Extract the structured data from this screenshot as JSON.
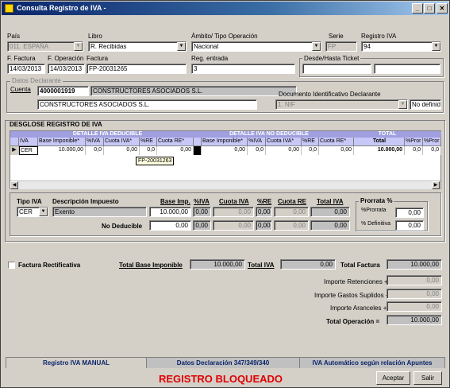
{
  "window": {
    "title": "Consulta Registro de IVA -"
  },
  "header": {
    "pais_label": "País",
    "pais_value": "011. ESPAÑA",
    "libro_label": "Libro",
    "libro_value": "R. Recibidas",
    "ambito_label": "Ámbito/ Tipo Operación",
    "ambito_value": "Nacional",
    "serie_label": "Serie",
    "serie_value": "FP",
    "registro_label": "Registro IVA",
    "registro_value": "94",
    "ffactura_label": "F. Factura",
    "ffactura_value": "14/03/2013",
    "foperacion_label": "F. Operación",
    "foperacion_value": "14/03/2013",
    "factura_label": "Factura",
    "factura_value": "FP-20031265",
    "regentrada_label": "Reg. entrada",
    "regentrada_value": "3",
    "desdehasta_label": "Desde/Hasta Ticket"
  },
  "declarante": {
    "group_label": "Datos Declarante",
    "cuenta_label": "Cuenta",
    "cuenta_value": "4000001919",
    "cuenta_name": "CONSTRUCTORES ASOCIADOS S.L.",
    "name_value": "CONSTRUCTORES ASOCIADOS S.L.",
    "doc_label": "Documento Identificativo Declarante",
    "doc_type": "1. NIF",
    "doc_value": "No definido"
  },
  "desglose": {
    "title": "DESGLOSE REGISTRO DE IVA",
    "group_deducible": "DETALLE IVA DEDUCIBLE",
    "group_nodeducible": "DETALLE IVA NO DEDUCIBLE",
    "group_total": "TOTAL",
    "columns": [
      "IVA",
      "Base Imponible*",
      "%IVA",
      "Cuota IVA*",
      "%RE",
      "Cuota RE*",
      "Base Imponible*",
      "%IVA",
      "Cuota IVA*",
      "%RE",
      "Cuota RE*",
      "Total",
      "%Pror",
      "%Pror"
    ],
    "row": [
      "CER",
      "10.000,00",
      "0,0",
      "0,00",
      "0,0",
      "0,00",
      "0,00",
      "0,0",
      "0,00",
      "0,0",
      "0,00",
      "10.000,00",
      "0,0",
      "0,0"
    ],
    "tooltip": "FP-20031263"
  },
  "detalle": {
    "tipo_label": "Tipo IVA",
    "tipo_value": "CER",
    "desc_label": "Descripción Impuesto",
    "desc_value": "Exento",
    "base_label": "Base Imp.",
    "piva_label": "%IVA",
    "cuota_label": "Cuota IVA",
    "pre_label": "%RE",
    "cuotare_label": "Cuota RE",
    "total_label": "Total IVA",
    "ded": {
      "base": "10.000,00",
      "piva": "0,00",
      "cuota": "0,00",
      "pre": "0,00",
      "cuotare": "0,00",
      "total": "0,00"
    },
    "nodeducible_label": "No  Deducible",
    "nd": {
      "base": "0,00",
      "piva": "0,00",
      "cuota": "0,00",
      "pre": "0,00",
      "cuotare": "0,00",
      "total": "0,00"
    },
    "prorrata_label": "Prorrata %",
    "prorrata_sub": "%Prorrata",
    "prorrata_value": "0,00",
    "definitiva_label": "% Definitiva",
    "definitiva_value": "0,00"
  },
  "totales": {
    "rectificativa_label": "Factura Rectificativa",
    "total_base_label": "Total Base Imponible",
    "total_base_value": "10.000,00",
    "total_iva_label": "Total IVA",
    "total_iva_value": "0,00",
    "total_factura_label": "Total Factura",
    "total_factura_value": "10.000,00",
    "retenciones_label": "Importe Retenciones +",
    "retenciones_value": "0,00",
    "gastos_label": "Importe Gastos Suplidos +",
    "gastos_value": "0,00",
    "aranceles_label": "Importe Aranceles +",
    "aranceles_value": "0,00",
    "total_op_label": "Total Operación =",
    "total_op_value": "10.000,00"
  },
  "tabs": [
    "Registro IVA MANUAL",
    "Datos Declaración 347/349/340",
    "IVA Automático según relación Apuntes"
  ],
  "footer": {
    "status": "REGISTRO BLOQUEADO",
    "aceptar": "Aceptar",
    "salir": "Salir",
    "status_color": "#e00000"
  }
}
